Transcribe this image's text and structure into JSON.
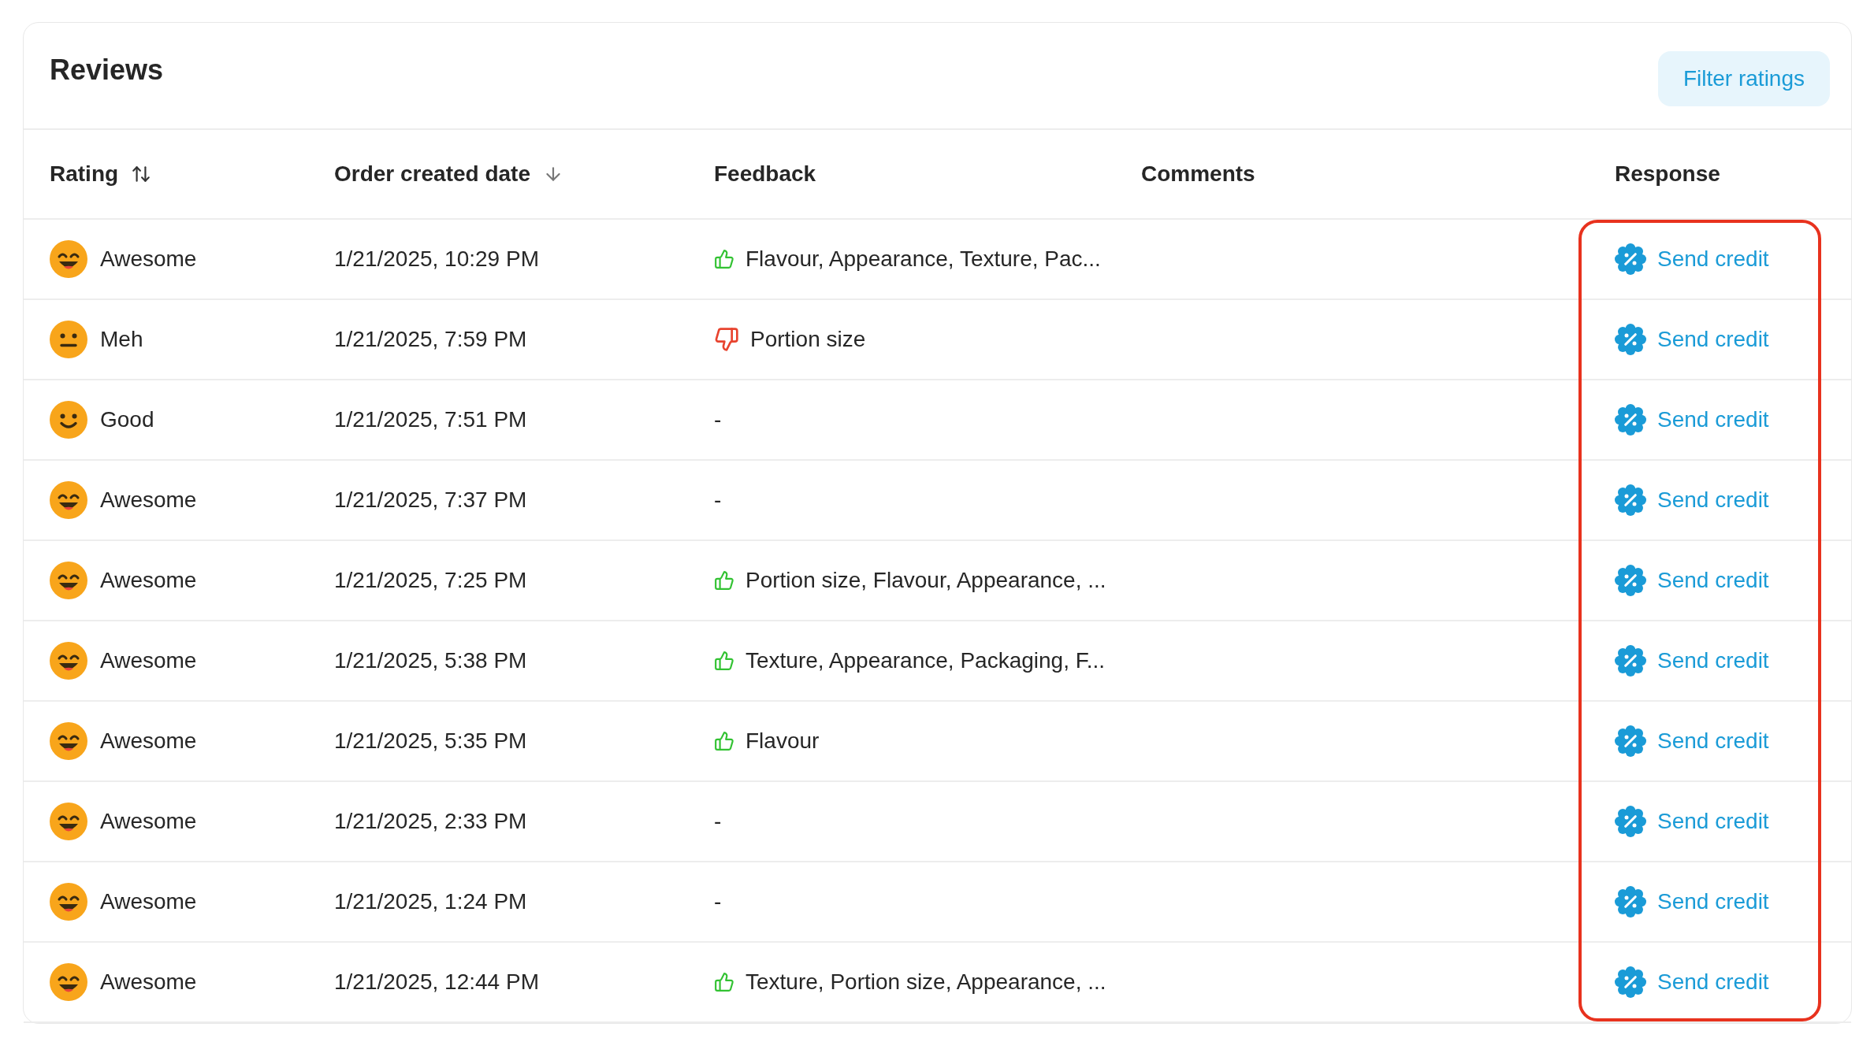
{
  "title": "Reviews",
  "filter_button": "Filter ratings",
  "response_highlighted": true,
  "columns": [
    {
      "label": "Rating",
      "kind": "sortable"
    },
    {
      "label": "Order created date",
      "kind": "descending"
    },
    {
      "label": "Feedback",
      "kind": "plain"
    },
    {
      "label": "Comments",
      "kind": "plain"
    },
    {
      "label": "Response",
      "kind": "plain"
    }
  ],
  "rows": [
    {
      "rating": {
        "kind": "awesome",
        "label": "Awesome"
      },
      "date": "1/21/2025, 10:29 PM",
      "feedback": {
        "kind": "positive",
        "text": "Flavour, Appearance, Texture, Pac..."
      },
      "response": "Send credit"
    },
    {
      "rating": {
        "kind": "meh",
        "label": "Meh"
      },
      "date": "1/21/2025, 7:59 PM",
      "feedback": {
        "kind": "negative",
        "text": "Portion size"
      },
      "response": "Send credit"
    },
    {
      "rating": {
        "kind": "good",
        "label": "Good"
      },
      "date": "1/21/2025, 7:51 PM",
      "feedback": {
        "kind": "empty",
        "text": "-"
      },
      "response": "Send credit"
    },
    {
      "rating": {
        "kind": "awesome",
        "label": "Awesome"
      },
      "date": "1/21/2025, 7:37 PM",
      "feedback": {
        "kind": "empty",
        "text": "-"
      },
      "response": "Send credit"
    },
    {
      "rating": {
        "kind": "awesome",
        "label": "Awesome"
      },
      "date": "1/21/2025, 7:25 PM",
      "feedback": {
        "kind": "positive",
        "text": "Portion size, Flavour, Appearance, ..."
      },
      "response": "Send credit"
    },
    {
      "rating": {
        "kind": "awesome",
        "label": "Awesome"
      },
      "date": "1/21/2025, 5:38 PM",
      "feedback": {
        "kind": "positive",
        "text": "Texture, Appearance, Packaging, F..."
      },
      "response": "Send credit"
    },
    {
      "rating": {
        "kind": "awesome",
        "label": "Awesome"
      },
      "date": "1/21/2025, 5:35 PM",
      "feedback": {
        "kind": "positive",
        "text": "Flavour"
      },
      "response": "Send credit"
    },
    {
      "rating": {
        "kind": "awesome",
        "label": "Awesome"
      },
      "date": "1/21/2025, 2:33 PM",
      "feedback": {
        "kind": "empty",
        "text": "-"
      },
      "response": "Send credit"
    },
    {
      "rating": {
        "kind": "awesome",
        "label": "Awesome"
      },
      "date": "1/21/2025, 1:24 PM",
      "feedback": {
        "kind": "empty",
        "text": "-"
      },
      "response": "Send credit"
    },
    {
      "rating": {
        "kind": "awesome",
        "label": "Awesome"
      },
      "date": "1/21/2025, 12:44 PM",
      "feedback": {
        "kind": "positive",
        "text": "Texture, Portion size, Appearance, ..."
      },
      "response": "Send credit"
    }
  ]
}
